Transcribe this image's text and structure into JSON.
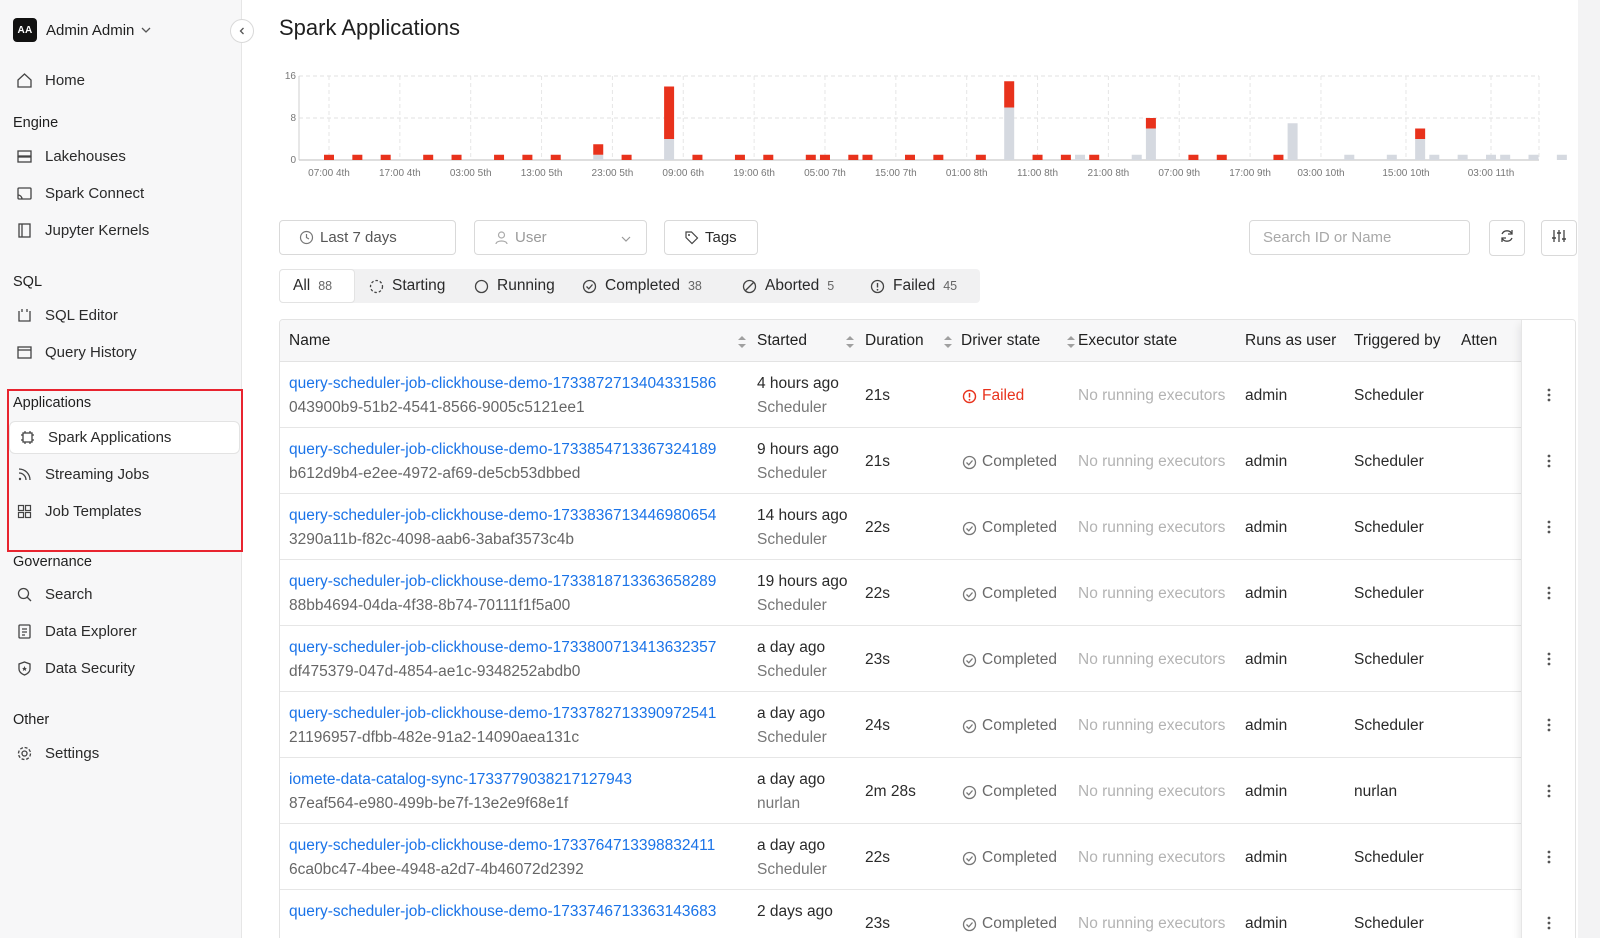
{
  "user": {
    "initials": "AA",
    "name": "Admin Admin"
  },
  "nav": {
    "home": "Home",
    "engine_head": "Engine",
    "lakehouses": "Lakehouses",
    "spark_connect": "Spark Connect",
    "jupyter": "Jupyter Kernels",
    "sql_head": "SQL",
    "sql_editor": "SQL Editor",
    "query_history": "Query History",
    "apps_head": "Applications",
    "spark_apps": "Spark Applications",
    "streaming": "Streaming Jobs",
    "templates": "Job Templates",
    "gov_head": "Governance",
    "search": "Search",
    "data_explorer": "Data Explorer",
    "data_security": "Data Security",
    "other_head": "Other",
    "settings": "Settings"
  },
  "page": {
    "title": "Spark Applications"
  },
  "filters": {
    "time": "Last 7 days",
    "user": "User",
    "tags": "Tags",
    "search_placeholder": "Search ID or Name"
  },
  "tabs": [
    {
      "label": "All",
      "count": "88"
    },
    {
      "label": "Starting",
      "count": ""
    },
    {
      "label": "Running",
      "count": ""
    },
    {
      "label": "Completed",
      "count": "38"
    },
    {
      "label": "Aborted",
      "count": "5"
    },
    {
      "label": "Failed",
      "count": "45"
    }
  ],
  "columns": {
    "name": "Name",
    "started": "Started",
    "duration": "Duration",
    "driver_state": "Driver state",
    "executor_state": "Executor state",
    "runs_as": "Runs as user",
    "triggered": "Triggered by",
    "attempts": "Atten"
  },
  "rows": [
    {
      "name": "query-scheduler-job-clickhouse-demo-1733872713404331586",
      "id": "043900b9-51b2-4541-8566-9005c5121ee1",
      "started": "4 hours ago",
      "by": "Scheduler",
      "duration": "21s",
      "state": "Failed",
      "executor": "No running executors",
      "user": "admin",
      "triggered": "Scheduler"
    },
    {
      "name": "query-scheduler-job-clickhouse-demo-1733854713367324189",
      "id": "b612d9b4-e2ee-4972-af69-de5cb53dbbed",
      "started": "9 hours ago",
      "by": "Scheduler",
      "duration": "21s",
      "state": "Completed",
      "executor": "No running executors",
      "user": "admin",
      "triggered": "Scheduler"
    },
    {
      "name": "query-scheduler-job-clickhouse-demo-1733836713446980654",
      "id": "3290a11b-f82c-4098-aab6-3abaf3573c4b",
      "started": "14 hours ago",
      "by": "Scheduler",
      "duration": "22s",
      "state": "Completed",
      "executor": "No running executors",
      "user": "admin",
      "triggered": "Scheduler"
    },
    {
      "name": "query-scheduler-job-clickhouse-demo-1733818713363658289",
      "id": "88bb4694-04da-4f38-8b74-70111f1f5a00",
      "started": "19 hours ago",
      "by": "Scheduler",
      "duration": "22s",
      "state": "Completed",
      "executor": "No running executors",
      "user": "admin",
      "triggered": "Scheduler"
    },
    {
      "name": "query-scheduler-job-clickhouse-demo-1733800713413632357",
      "id": "df475379-047d-4854-ae1c-9348252abdb0",
      "started": "a day ago",
      "by": "Scheduler",
      "duration": "23s",
      "state": "Completed",
      "executor": "No running executors",
      "user": "admin",
      "triggered": "Scheduler"
    },
    {
      "name": "query-scheduler-job-clickhouse-demo-1733782713390972541",
      "id": "21196957-dfbb-482e-91a2-14090aea131c",
      "started": "a day ago",
      "by": "Scheduler",
      "duration": "24s",
      "state": "Completed",
      "executor": "No running executors",
      "user": "admin",
      "triggered": "Scheduler"
    },
    {
      "name": "iomete-data-catalog-sync-1733779038217127943",
      "id": "87eaf564-e980-499b-be7f-13e2e9f68e1f",
      "started": "a day ago",
      "by": "nurlan",
      "duration": "2m 28s",
      "state": "Completed",
      "executor": "No running executors",
      "user": "admin",
      "triggered": "nurlan"
    },
    {
      "name": "query-scheduler-job-clickhouse-demo-1733764713398832411",
      "id": "6ca0bc47-4bee-4948-a2d7-4b46072d2392",
      "started": "a day ago",
      "by": "Scheduler",
      "duration": "22s",
      "state": "Completed",
      "executor": "No running executors",
      "user": "admin",
      "triggered": "Scheduler"
    },
    {
      "name": "query-scheduler-job-clickhouse-demo-1733746713363143683",
      "id": "",
      "started": "2 days ago",
      "by": "",
      "duration": "23s",
      "state": "Completed",
      "executor": "No running executors",
      "user": "admin",
      "triggered": "Scheduler"
    }
  ],
  "colors": {
    "failed": "#e8321c",
    "success": "#d5d9e0",
    "link": "#1a73e8",
    "highlight": "#e8242f"
  },
  "chart_data": {
    "type": "bar",
    "ylim": [
      0,
      16
    ],
    "yticks": [
      "16",
      "8",
      "0"
    ],
    "xticks": [
      "07:00 4th",
      "17:00 4th",
      "03:00 5th",
      "13:00 5th",
      "23:00 5th",
      "09:00 6th",
      "19:00 6th",
      "05:00 7th",
      "15:00 7th",
      "01:00 8th",
      "11:00 8th",
      "21:00 8th",
      "07:00 9th",
      "17:00 9th",
      "03:00 10th",
      "15:00 10th",
      "03:00 11th"
    ],
    "hours_from_first_tick": [
      0,
      4,
      8,
      14,
      18,
      24,
      28,
      32,
      38,
      42,
      48,
      52,
      58,
      62,
      68,
      70,
      74,
      76,
      82,
      86,
      92,
      96,
      100,
      104,
      106,
      108,
      114,
      116,
      118,
      122,
      126,
      130,
      134,
      136,
      138,
      142,
      144,
      146,
      150,
      154,
      156,
      160,
      164,
      166,
      170,
      174,
      178,
      180,
      184,
      186,
      190,
      192,
      196,
      202,
      206,
      212
    ],
    "series": [
      {
        "name": "Failed",
        "values": [
          1,
          1,
          1,
          1,
          1,
          1,
          1,
          1,
          2,
          1,
          10,
          1,
          1,
          1,
          1,
          1,
          1,
          1,
          1,
          1,
          1,
          5,
          1,
          1,
          0,
          1,
          0,
          2,
          0,
          1,
          1,
          0,
          1,
          0,
          0,
          0,
          0,
          0,
          0,
          2,
          0,
          0,
          0,
          0,
          0,
          0,
          0,
          0,
          0,
          0,
          0,
          0,
          0,
          0,
          0,
          1
        ]
      },
      {
        "name": "Success",
        "values": [
          0,
          0,
          0,
          0,
          0,
          0,
          0,
          0,
          1,
          0,
          4,
          0,
          0,
          0,
          0,
          0,
          0,
          0,
          0,
          0,
          0,
          10,
          0,
          0,
          1,
          0,
          1,
          6,
          0,
          0,
          0,
          0,
          0,
          7,
          0,
          0,
          1,
          0,
          1,
          4,
          1,
          1,
          1,
          1,
          1,
          1,
          1,
          1,
          1,
          1,
          1,
          1,
          1,
          1,
          1,
          0
        ]
      }
    ]
  }
}
